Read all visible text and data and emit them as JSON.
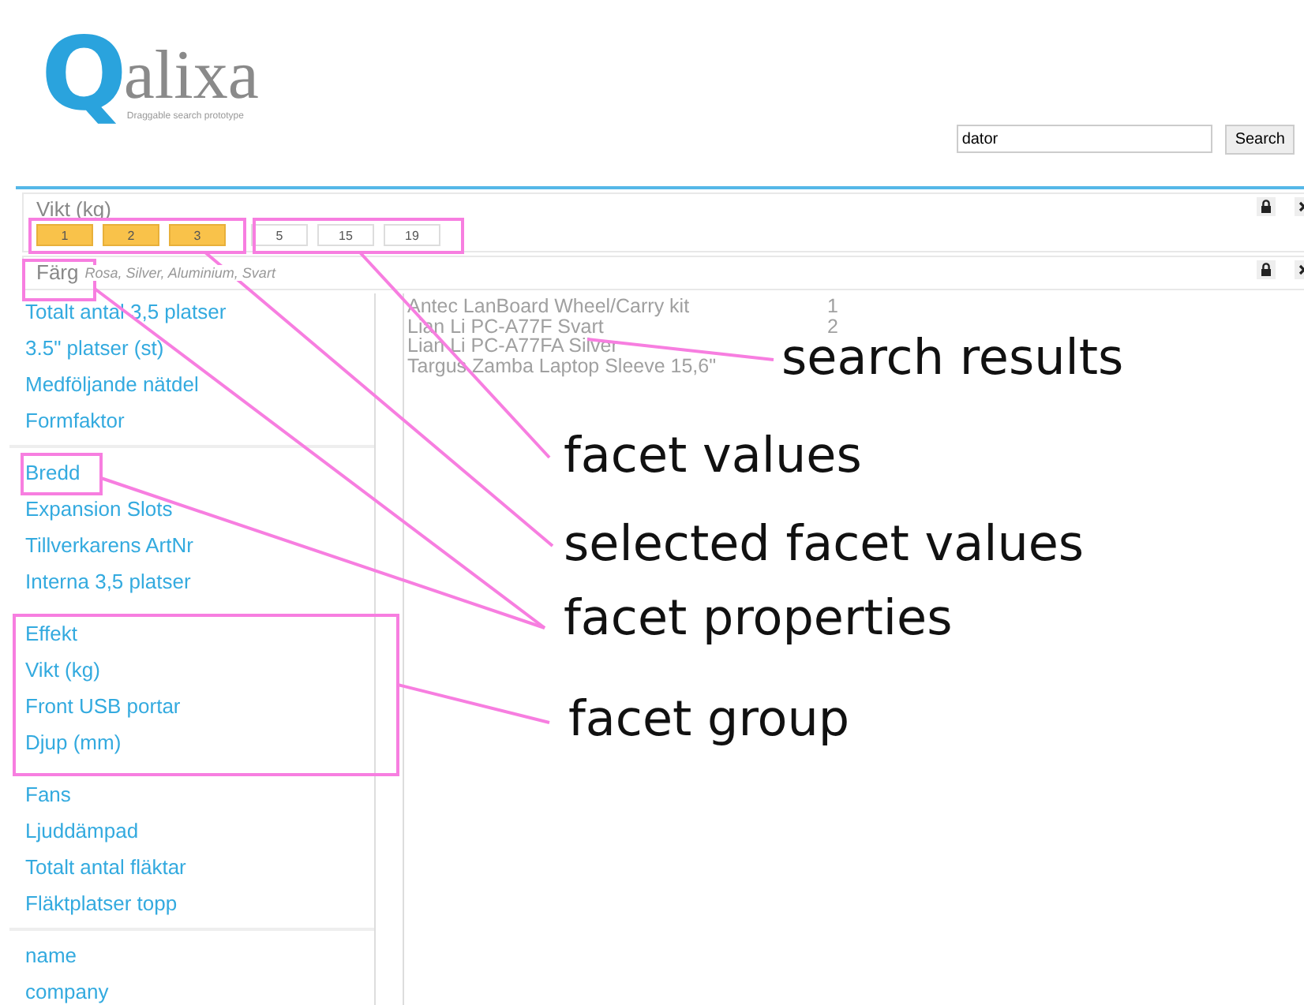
{
  "logo": {
    "initial": "Q",
    "name": "alixa",
    "tagline": "Draggable search prototype"
  },
  "search": {
    "value": "dator",
    "button": "Search"
  },
  "facets": [
    {
      "kind": "values",
      "label": "Vikt (kg)",
      "values": [
        {
          "label": "1",
          "selected": true
        },
        {
          "label": "2",
          "selected": true
        },
        {
          "label": "3",
          "selected": true
        },
        {
          "label": "5",
          "selected": false
        },
        {
          "label": "15",
          "selected": false
        },
        {
          "label": "19",
          "selected": false
        }
      ]
    },
    {
      "kind": "summary",
      "label": "Färg",
      "summary": "Rosa, Silver, Aluminium, Svart"
    }
  ],
  "sidebar": {
    "sections": [
      {
        "groups": [
          {
            "items": [
              "Totalt antal 3,5 platser",
              "3.5\" platser (st)",
              "Medföljande nätdel",
              "Formfaktor"
            ]
          }
        ]
      },
      {
        "groups": [
          {
            "items": [
              "Bredd",
              "Expansion Slots",
              "Tillverkarens ArtNr",
              "Interna 3,5 platser"
            ]
          },
          {
            "items": [
              "Effekt",
              "Vikt (kg)",
              "Front USB portar",
              "Djup (mm)"
            ]
          },
          {
            "items": [
              "Fans",
              "Ljuddämpad",
              "Totalt antal fläktar",
              "Fläktplatser topp"
            ]
          }
        ]
      },
      {
        "groups": [
          {
            "items": [
              "name",
              "company"
            ]
          }
        ]
      }
    ]
  },
  "results": [
    {
      "name": "Antec LanBoard Wheel/Carry kit",
      "count": "1"
    },
    {
      "name": "Lian Li PC-A77F Svart",
      "count": "2"
    },
    {
      "name": "Lian Li PC-A77FA Silver"
    },
    {
      "name": "Targus Zamba Laptop Sleeve 15,6\""
    }
  ],
  "annotations": [
    "search results",
    "facet values",
    "selected facet values",
    "facet properties",
    "facet group"
  ]
}
